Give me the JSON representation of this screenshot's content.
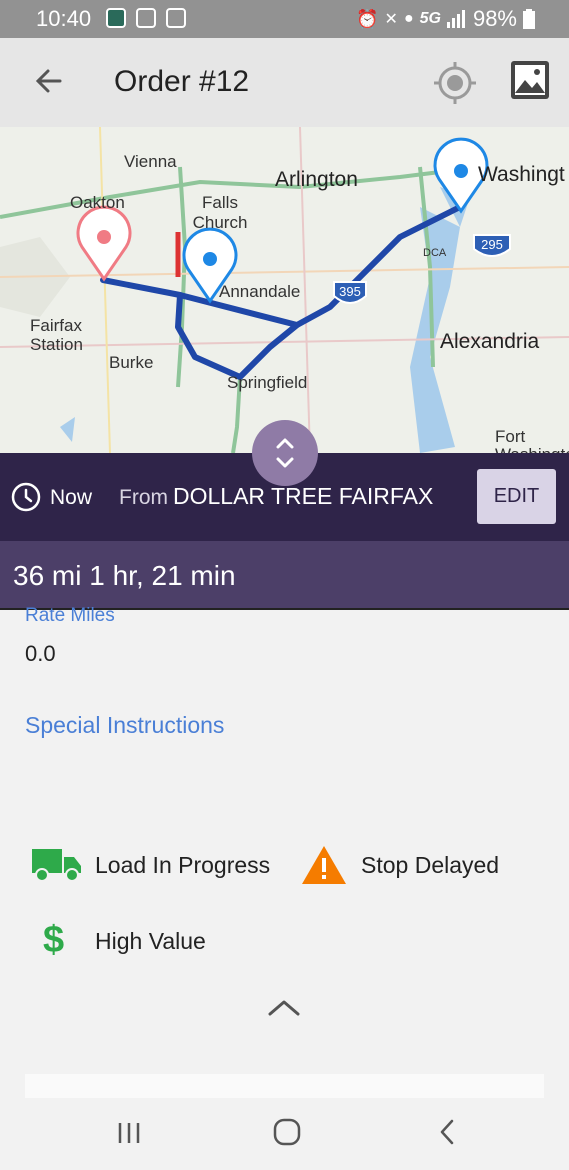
{
  "status_bar": {
    "time": "10:40",
    "network": "5G",
    "battery": "98%"
  },
  "app_bar": {
    "title": "Order #12"
  },
  "map": {
    "labels": [
      "Vienna",
      "Oakton",
      "Falls Church",
      "Arlington",
      "Washingt",
      "Annandale",
      "Fairfax Station",
      "Burke",
      "Springfield",
      "Alexandria",
      "Fort Washington",
      "DCA"
    ],
    "highways": [
      "395",
      "295"
    ]
  },
  "route": {
    "time_label": "Now",
    "from_label": "From",
    "destination": "DOLLAR TREE FAIRFAX",
    "edit_label": "EDIT",
    "summary": "36 mi 1 hr, 21 min"
  },
  "details": {
    "rate_miles_label": "Rate Miles",
    "rate_miles_value": "0.0",
    "special_instructions_label": "Special Instructions"
  },
  "statuses": [
    {
      "label": "Load In Progress",
      "icon": "truck-icon",
      "color": "#2eaa4a"
    },
    {
      "label": "Stop Delayed",
      "icon": "warning-icon",
      "color": "#f57c00"
    },
    {
      "label": "High Value",
      "icon": "dollar-icon",
      "color": "#2eaa4a"
    }
  ]
}
